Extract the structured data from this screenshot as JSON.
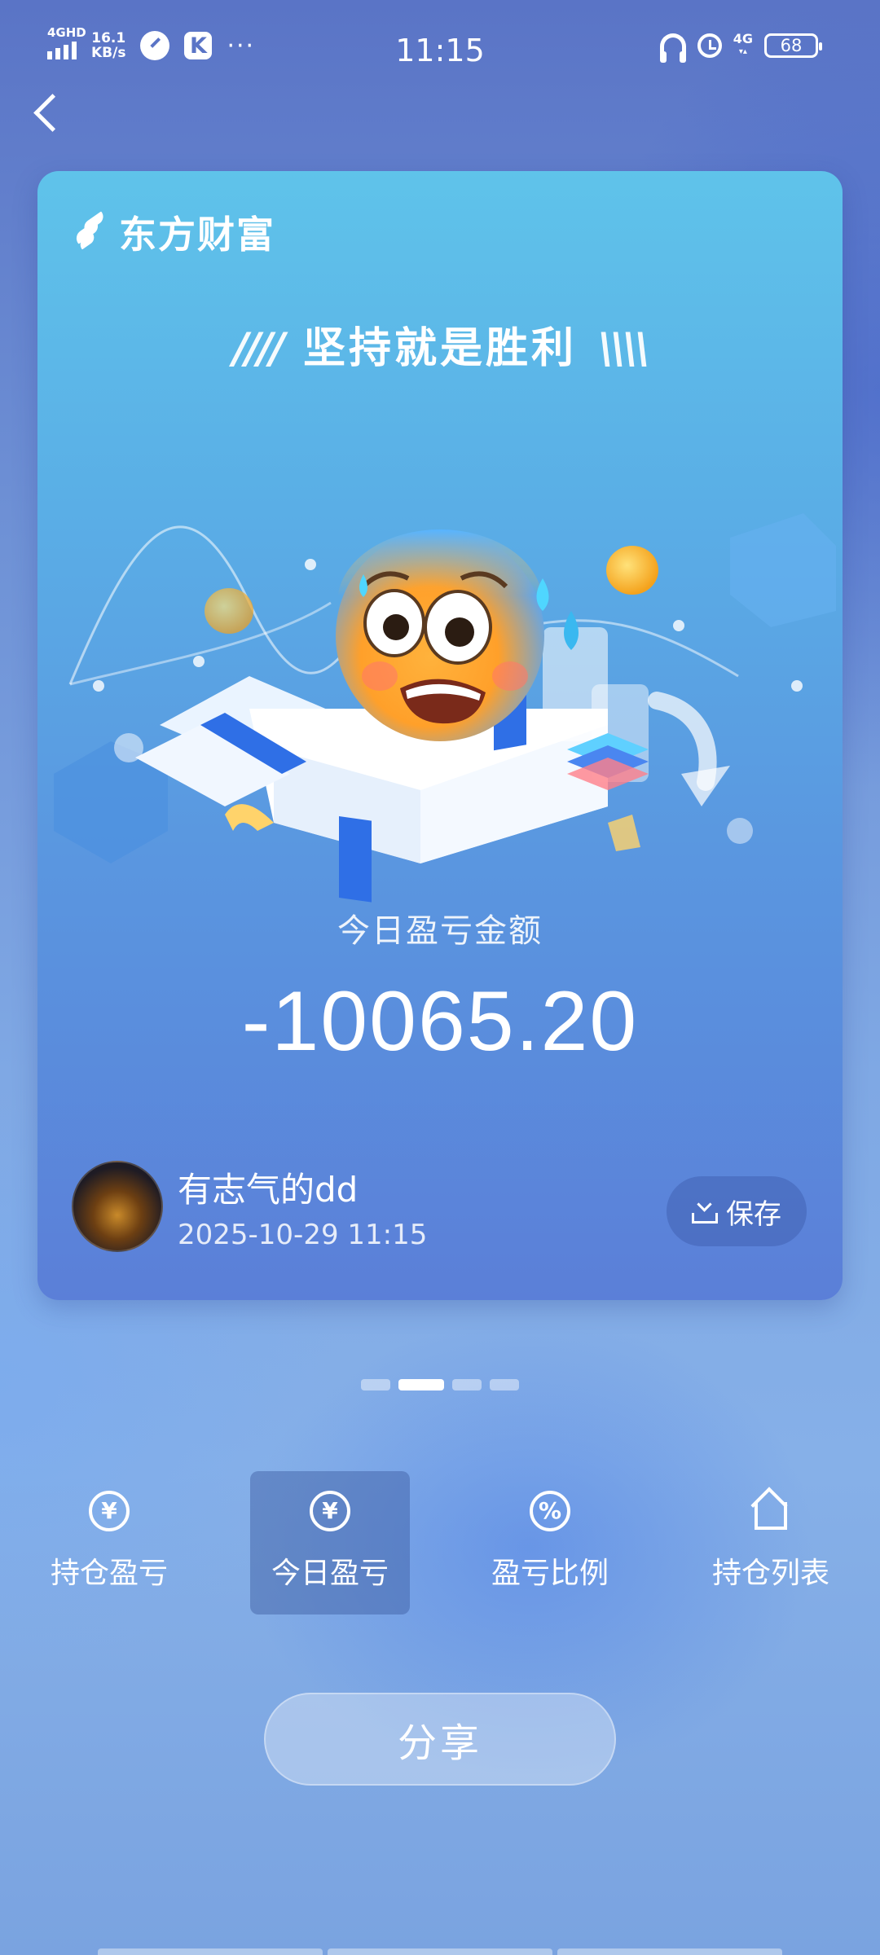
{
  "status_bar": {
    "network_type": "4GHD",
    "speed_value": "16.1",
    "speed_unit": "KB/s",
    "k_badge": "K",
    "more": "···",
    "time": "11:15",
    "lte": "4G",
    "battery": "68"
  },
  "card": {
    "brand": "东方财富",
    "slogan": "坚持就是胜利",
    "slogan_left": "////",
    "slogan_right": "\\\\\\\\",
    "amount_label": "今日盈亏金额",
    "amount": "-10065.20",
    "user_name": "有志气的dd",
    "timestamp": "2025-10-29 11:15",
    "save_label": "保存"
  },
  "pager": {
    "count": 4,
    "active_index": 1
  },
  "tabs": [
    {
      "label": "持仓盈亏",
      "icon": "yen-circle-icon",
      "glyph": "¥",
      "active": false
    },
    {
      "label": "今日盈亏",
      "icon": "yen-circle-icon",
      "glyph": "¥",
      "active": true
    },
    {
      "label": "盈亏比例",
      "icon": "percent-circle-icon",
      "glyph": "%",
      "active": false
    },
    {
      "label": "持仓列表",
      "icon": "house-list-icon",
      "glyph": "",
      "active": false
    }
  ],
  "share_label": "分享",
  "colors": {
    "card_top": "#5fc3ea",
    "card_bottom": "#5b7fd8",
    "accent_blue": "#2f6fe6"
  }
}
